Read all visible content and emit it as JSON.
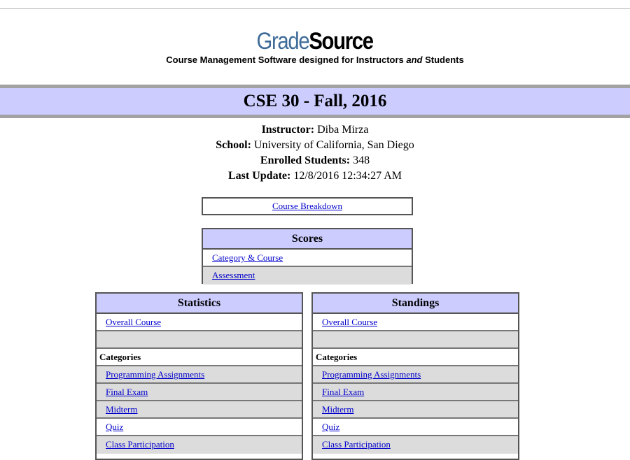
{
  "logo": {
    "grade": "Grade",
    "source": "Source"
  },
  "tagline": {
    "part1": "Course Management Software designed for Instructors ",
    "and": "and",
    "part2": " Students"
  },
  "course_title": "CSE 30 - Fall, 2016",
  "info": {
    "instructor_label": "Instructor:",
    "instructor": "Diba Mirza",
    "school_label": "School:",
    "school": "University of California, San Diego",
    "enrolled_label": "Enrolled Students:",
    "enrolled": "348",
    "update_label": "Last Update:",
    "update": "12/8/2016 12:34:27 AM"
  },
  "breakdown_link": "Course Breakdown",
  "scores": {
    "header": "Scores",
    "links": [
      "Category & Course",
      "Assessment"
    ]
  },
  "statistics": {
    "header": "Statistics",
    "overall": "Overall Course",
    "categories_label": "Categories",
    "categories": [
      "Programming Assignments",
      "Final Exam",
      "Midterm",
      "Quiz",
      "Class Participation"
    ]
  },
  "standings": {
    "header": "Standings",
    "overall": "Overall Course",
    "categories_label": "Categories",
    "categories": [
      "Programming Assignments",
      "Final Exam",
      "Midterm",
      "Quiz",
      "Class Participation"
    ]
  }
}
